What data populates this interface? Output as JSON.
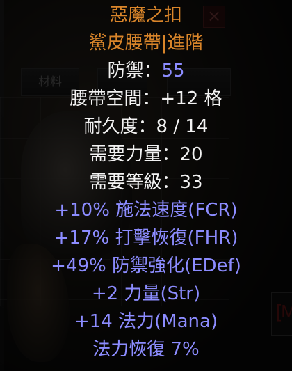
{
  "background": {
    "tabs": [
      "材料",
      "",
      ""
    ],
    "right_panel_text": "[M"
  },
  "tooltip": {
    "item_name": "惡魔之扣",
    "item_type": "鯊皮腰帶|進階",
    "defense": {
      "label": "防禦：",
      "value": "55"
    },
    "belt_size": "腰帶空間：+12 格",
    "durability": "耐久度：8 / 14",
    "req_str": "需要力量：20",
    "req_level": "需要等級：33",
    "mods": [
      "+10% 施法速度(FCR)",
      "+17% 打擊恢復(FHR)",
      "+49% 防禦強化(EDef)",
      "+2 力量(Str)",
      "+14 法力(Mana)",
      "法力恢復 7%"
    ]
  },
  "colors": {
    "unique_gold": "#d9852a",
    "magic_blue": "#8c8cff",
    "base_white": "#f2f2f2"
  }
}
